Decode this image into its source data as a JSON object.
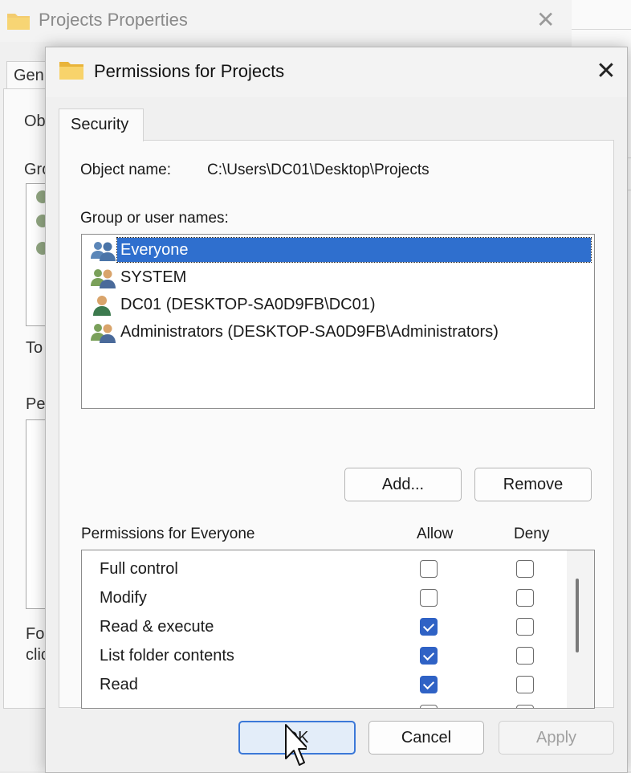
{
  "background_window": {
    "title": "Projects Properties",
    "tab_fragment": "Gen",
    "fragments": [
      "Ob",
      "Gro",
      "To",
      "Pe",
      "For",
      "clic"
    ]
  },
  "dialog": {
    "title": "Permissions for Projects",
    "tab_label": "Security",
    "object_name_label": "Object name:",
    "object_name_value": "C:\\Users\\DC01\\Desktop\\Projects",
    "group_label": "Group or user names:",
    "users": [
      {
        "name": "Everyone",
        "icon": "group-users-icon",
        "selected": true
      },
      {
        "name": "SYSTEM",
        "icon": "system-users-icon",
        "selected": false
      },
      {
        "name": "DC01 (DESKTOP-SA0D9FB\\DC01)",
        "icon": "single-user-icon",
        "selected": false
      },
      {
        "name": "Administrators (DESKTOP-SA0D9FB\\Administrators)",
        "icon": "admin-users-icon",
        "selected": false
      }
    ],
    "add_button": "Add...",
    "remove_button": "Remove",
    "permissions_label": "Permissions for Everyone",
    "allow_label": "Allow",
    "deny_label": "Deny",
    "permissions": [
      {
        "name": "Full control",
        "allow": false,
        "deny": false
      },
      {
        "name": "Modify",
        "allow": false,
        "deny": false
      },
      {
        "name": "Read & execute",
        "allow": true,
        "deny": false
      },
      {
        "name": "List folder contents",
        "allow": true,
        "deny": false
      },
      {
        "name": "Read",
        "allow": true,
        "deny": false
      }
    ],
    "ok_button": "OK",
    "cancel_button": "Cancel",
    "apply_button": "Apply"
  },
  "colors": {
    "accent": "#2f62c5",
    "selection": "#2f6fce"
  }
}
